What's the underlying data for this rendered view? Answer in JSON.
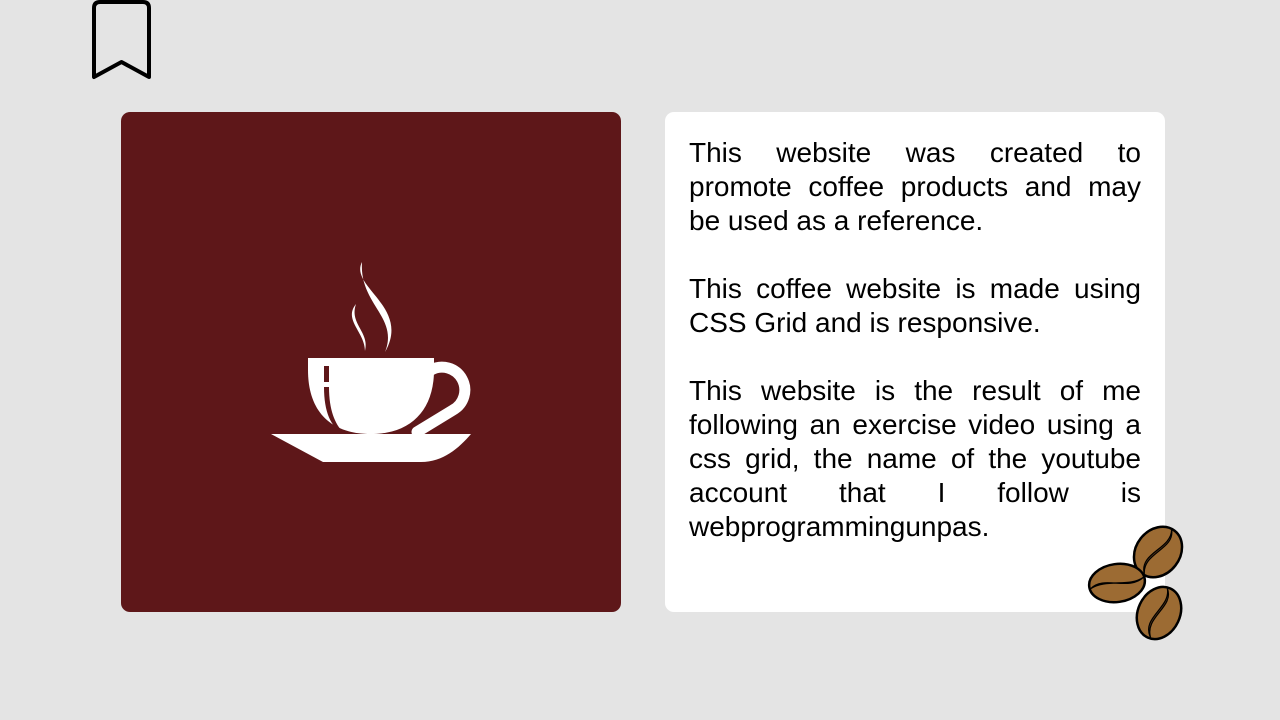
{
  "header": {
    "bookmark_icon": "bookmark-icon"
  },
  "hero": {
    "icon": "coffee-cup-icon",
    "background": "#5e1719"
  },
  "about": {
    "paragraphs": [
      "This website was created to promote coffee products and may be used as a reference.",
      "This coffee website is made using CSS Grid and is responsive.",
      "This website is the result of me following an exercise video using a css grid, the name of the youtube account that I follow is webprogrammingunpas."
    ]
  },
  "decoration": {
    "icon": "coffee-beans-icon",
    "bean_color": "#9c6b33"
  }
}
